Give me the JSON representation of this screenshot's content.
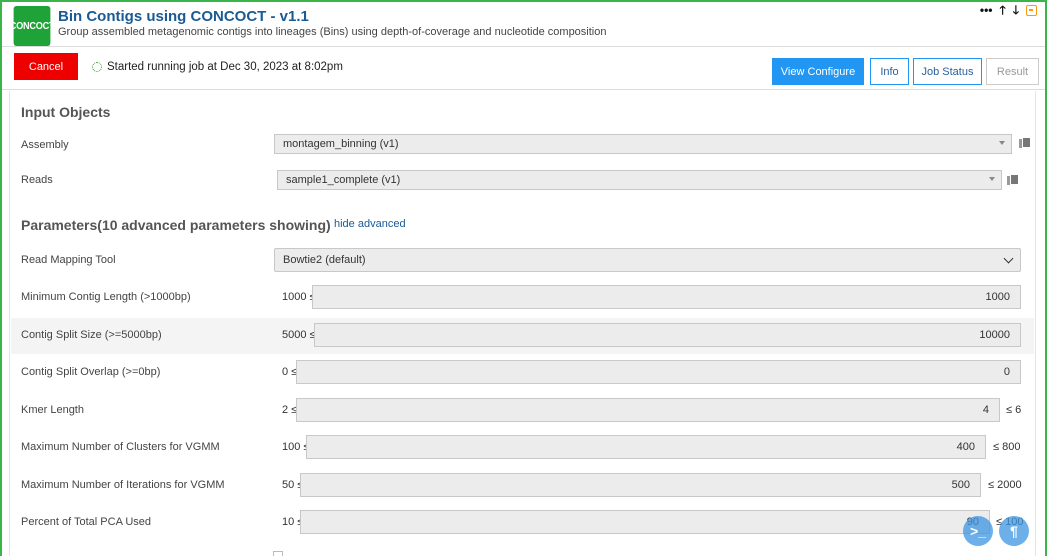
{
  "header": {
    "logo_text": "CONCOCT",
    "title": "Bin Contigs using CONCOCT - v1.1",
    "subtitle": "Group assembled metagenomic contigs into lineages (Bins) using depth-of-coverage and nucleotide composition",
    "controls": {
      "more": "•••",
      "up": "🡑",
      "down": "🡓"
    },
    "accent_color": "#1fa237"
  },
  "toolbar": {
    "cancel_label": "Cancel",
    "status_text": "Started running job at Dec 30, 2023 at 8:02pm",
    "tabs": [
      {
        "label": "View Configure",
        "active": true
      },
      {
        "label": "Info",
        "active": false
      },
      {
        "label": "Job Status",
        "active": false
      },
      {
        "label": "Result",
        "active": false
      }
    ]
  },
  "input_objects": {
    "title": "Input Objects",
    "assembly": {
      "label": "Assembly",
      "value": "montagem_binning (v1)"
    },
    "reads": {
      "label": "Reads",
      "value": "sample1_complete (v1)"
    }
  },
  "parameters": {
    "title": "Parameters(10 advanced parameters showing)",
    "hide_advanced_label": "hide advanced",
    "read_mapping_tool": {
      "label": "Read Mapping Tool",
      "value": "Bowtie2 (default)"
    },
    "min_contig_length": {
      "label": "Minimum Contig Length (>1000bp)",
      "prefix": "1000 ≤",
      "value": "1000",
      "suffix": ""
    },
    "contig_split_size": {
      "label": "Contig Split Size (>=5000bp)",
      "prefix": "5000 ≤",
      "value": "10000",
      "suffix": ""
    },
    "contig_split_overlap": {
      "label": "Contig Split Overlap (>=0bp)",
      "prefix": "0 ≤",
      "value": "0",
      "suffix": ""
    },
    "kmer_length": {
      "label": "Kmer Length",
      "prefix": "2 ≤",
      "value": "4",
      "suffix": "≤ 6"
    },
    "max_clusters": {
      "label": "Maximum Number of Clusters for VGMM",
      "prefix": "100 ≤",
      "value": "400",
      "suffix": "≤ 800"
    },
    "max_iterations": {
      "label": "Maximum Number of Iterations for VGMM",
      "prefix": "50 ≤",
      "value": "500",
      "suffix": "≤ 2000"
    },
    "pca_percent": {
      "label": "Percent of Total PCA Used",
      "prefix": "10 ≤",
      "value": "90",
      "suffix": "≤ 100"
    }
  },
  "floating": {
    "terminal_icon": ">_",
    "paragraph_icon": "¶"
  }
}
